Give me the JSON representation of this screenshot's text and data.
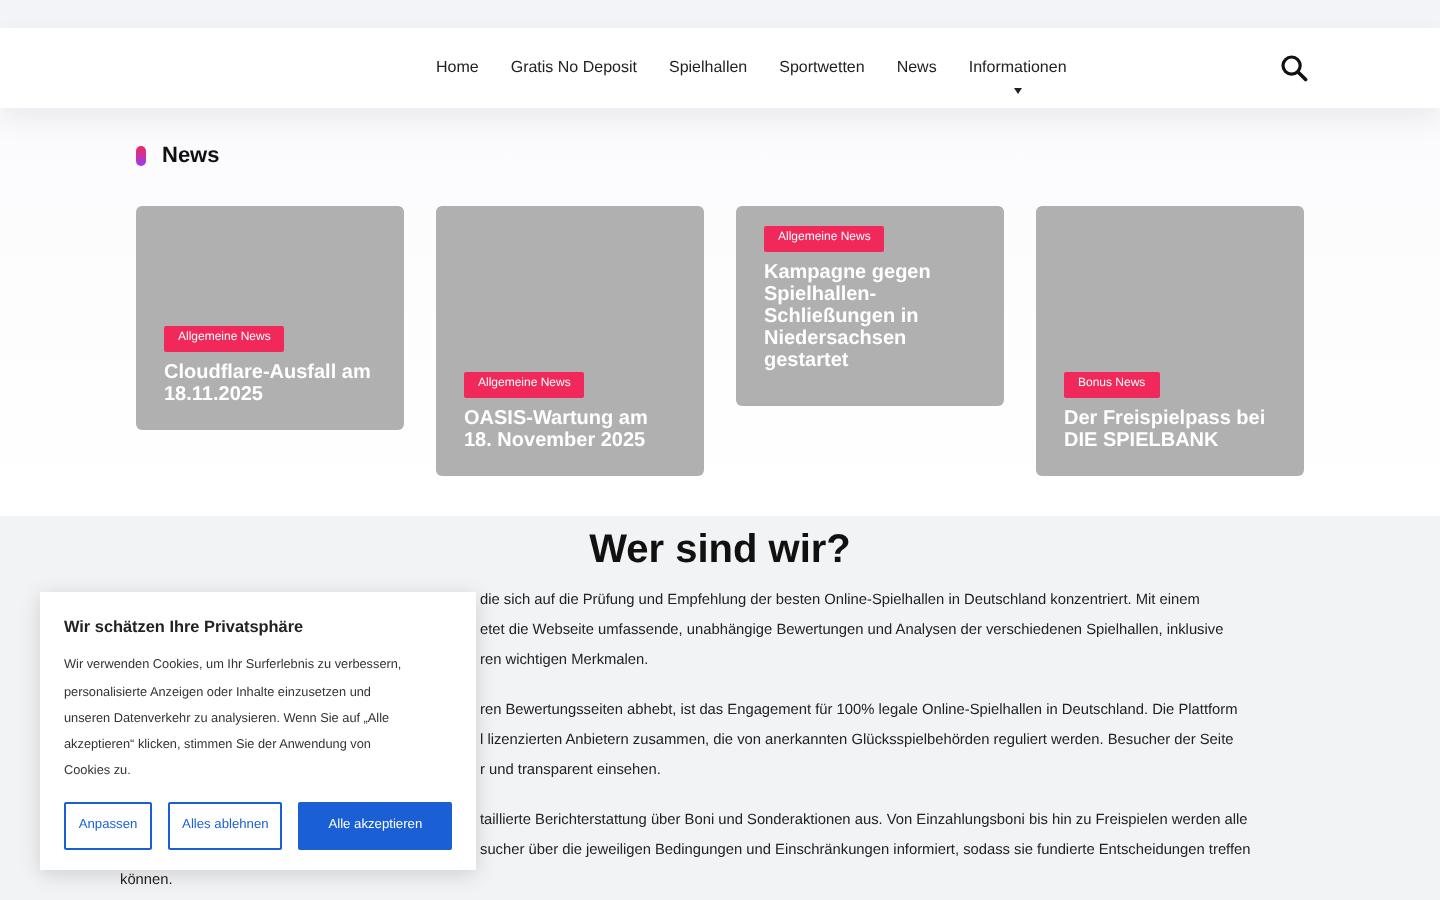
{
  "nav": {
    "items": [
      {
        "label": "Home",
        "dropdown": false
      },
      {
        "label": "Gratis No Deposit",
        "dropdown": false
      },
      {
        "label": "Spielhallen",
        "dropdown": false
      },
      {
        "label": "Sportwetten",
        "dropdown": false
      },
      {
        "label": "News",
        "dropdown": false
      },
      {
        "label": "Informationen",
        "dropdown": true
      }
    ]
  },
  "news": {
    "heading": "News",
    "cards": [
      {
        "tag": "Allgemeine News",
        "title": "Cloudflare-Ausfall am 18.11.2025"
      },
      {
        "tag": "Allgemeine News",
        "title": "OASIS-Wartung am 18. November 2025"
      },
      {
        "tag": "Allgemeine News",
        "title": "Kampagne gegen Spielhallen-Schließungen in Niedersachsen gestartet"
      },
      {
        "tag": "Bonus News",
        "title": "Der Freispielpass bei DIE SPIELBANK"
      }
    ]
  },
  "about": {
    "heading": "Wer sind wir?",
    "paragraphs": [
      {
        "lines": [
          {
            "kind": "partial",
            "text": "die sich auf die Prüfung und Empfehlung der besten Online-Spielhallen in Deutschland konzentriert. Mit einem"
          },
          {
            "kind": "partial",
            "text": "etet die Webseite umfassende, unabhängige Bewertungen und Analysen der verschiedenen Spielhallen, inklusive"
          },
          {
            "kind": "partial",
            "text": "ren wichtigen Merkmalen."
          }
        ]
      },
      {
        "lines": [
          {
            "kind": "partial",
            "text": "ren Bewertungsseiten abhebt, ist das Engagement für 100% legale Online-Spielhallen in Deutschland. Die Plattform"
          },
          {
            "kind": "partial",
            "text": "l lizenzierten Anbietern zusammen, die von anerkannten Glücksspielbehörden reguliert werden. Besucher der Seite"
          },
          {
            "kind": "partial",
            "text": "r und transparent einsehen."
          }
        ]
      },
      {
        "lines": [
          {
            "kind": "partial",
            "text": "taillierte Berichterstattung über Boni und Sonderaktionen aus. Von Einzahlungsboni bis hin zu Freispielen werden alle"
          },
          {
            "kind": "partial",
            "text": "sucher über die jeweiligen Bedingungen und Einschränkungen informiert, sodass sie fundierte Entscheidungen treffen"
          },
          {
            "kind": "full",
            "text": "können."
          }
        ]
      }
    ]
  },
  "cookie_banner": {
    "title": "Wir schätzen Ihre Privatsphäre",
    "text": "Wir verwenden Cookies, um Ihr Surferlebnis zu verbessern, personalisierte Anzeigen oder Inhalte einzusetzen und unseren Datenverkehr zu analysieren. Wenn Sie auf „Alle akzeptieren“ klicken, stimmen Sie der Anwendung von Cookies zu.",
    "buttons": [
      {
        "label": "Anpassen",
        "primary": false
      },
      {
        "label": "Alles ablehnen",
        "primary": false
      },
      {
        "label": "Alle akzeptieren",
        "primary": true
      }
    ]
  }
}
